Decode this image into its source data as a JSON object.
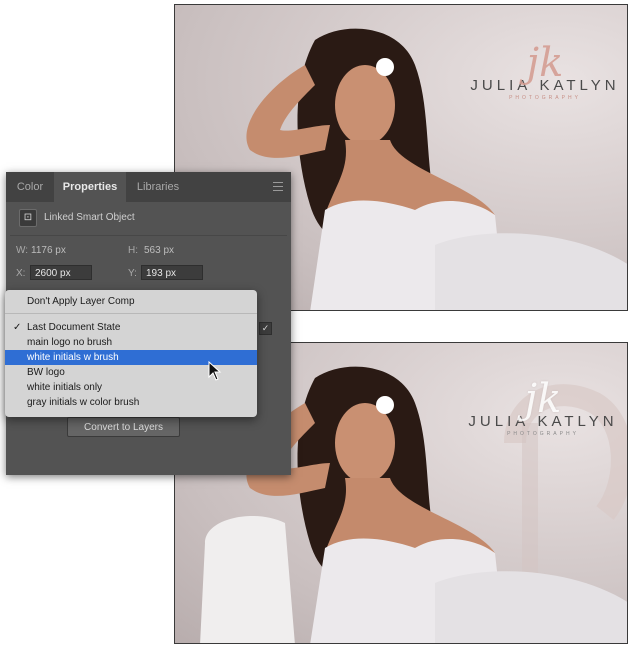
{
  "panel": {
    "tabs": [
      "Color",
      "Properties",
      "Libraries"
    ],
    "active_tab": "Properties",
    "layer_type": "Linked Smart Object",
    "width_label": "W:",
    "width_value": "1176 px",
    "height_label": "H:",
    "height_value": "563 px",
    "x_label": "X:",
    "x_value": "2600 px",
    "y_label": "Y:",
    "y_value": "193 px",
    "convert_button": "Convert to Layers"
  },
  "layer_comp_menu": {
    "items": [
      {
        "label": "Don't Apply Layer Comp",
        "checked": false,
        "selected": false
      },
      {
        "label": "Last Document State",
        "checked": true,
        "selected": false
      },
      {
        "label": "main logo no brush",
        "checked": false,
        "selected": false
      },
      {
        "label": "white initials w brush",
        "checked": false,
        "selected": true
      },
      {
        "label": "BW logo",
        "checked": false,
        "selected": false
      },
      {
        "label": "white initials only",
        "checked": false,
        "selected": false
      },
      {
        "label": "gray initials w color brush",
        "checked": false,
        "selected": false
      }
    ],
    "check_glyph": "✓",
    "selection_color": "#2f6ed4"
  },
  "photos": {
    "top": {
      "logo_initials": "jk",
      "logo_name_1": "JULIA",
      "logo_name_2": "KATLYN",
      "logo_sub": "PHOTOGRAPHY"
    },
    "bottom": {
      "logo_initials": "jk",
      "logo_name_1": "JULIA",
      "logo_name_2": "KATLYN",
      "logo_sub": "PHOTOGRAPHY"
    }
  },
  "icons": {
    "smart_object": "smart-object-icon",
    "panel_menu": "panel-menu-icon",
    "cursor": "mouse-pointer-icon"
  }
}
